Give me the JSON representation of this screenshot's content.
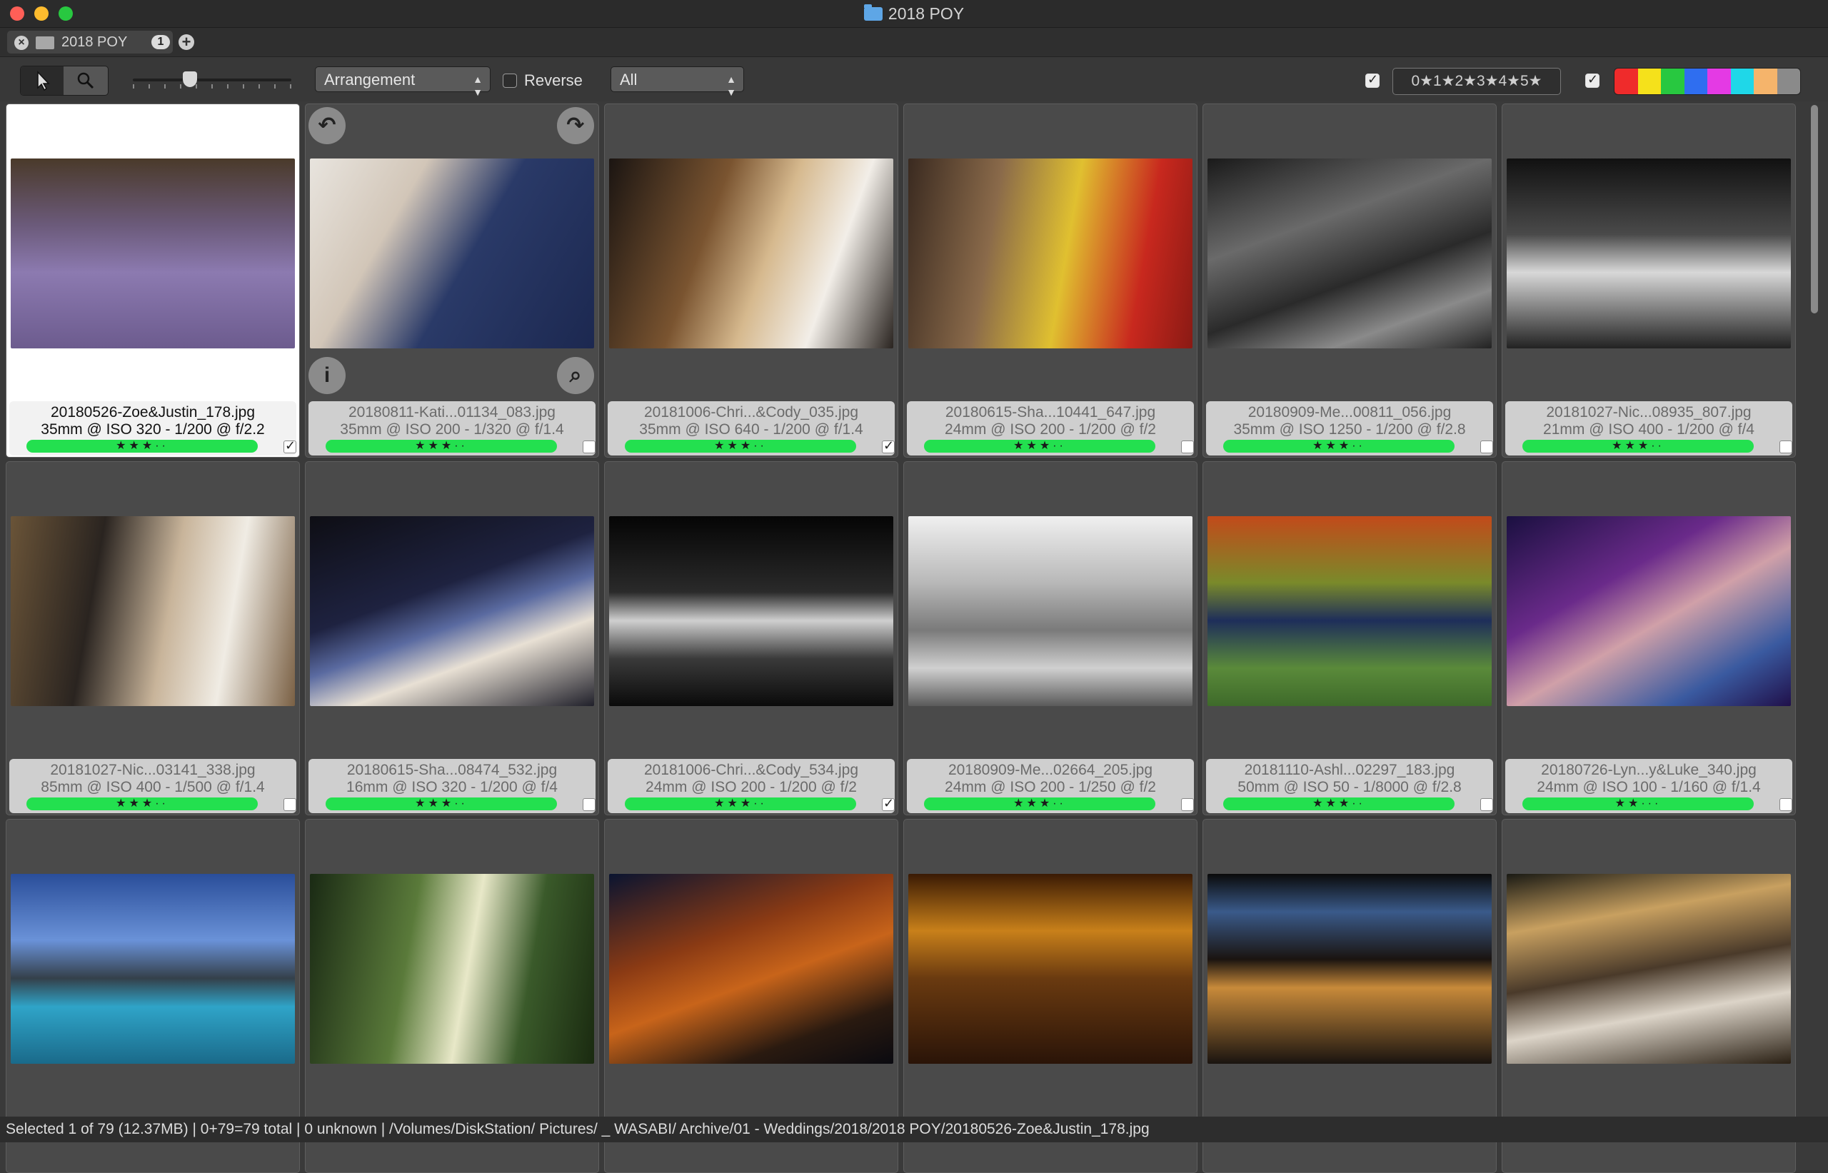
{
  "window": {
    "title": "2018 POY"
  },
  "tab": {
    "label": "2018 POY",
    "count": "1"
  },
  "toolbar": {
    "sort": "Arrangement",
    "reverse_label": "Reverse",
    "filter": "All",
    "rating_filter": "0★1★2★3★4★5★",
    "color_labels": [
      "#ef2b2b",
      "#f5e11b",
      "#28c840",
      "#2f6ef0",
      "#e43ae4",
      "#1fd7e8",
      "#f5b46b",
      "#8a8a8a"
    ]
  },
  "grid": {
    "cells": [
      {
        "file": "20180526-Zoe&Justin_178.jpg",
        "exif": "35mm @ ISO 320 - 1/200 @ f/2.2",
        "stars": "★★★··",
        "checked": true,
        "selected": true,
        "thumb": "linear-gradient(180deg,#4a3a2a 0%,#6b5a7a 35%,#8c7ab0 60%,#6c5b8e 100%)"
      },
      {
        "file": "20180811-Kati...01134_083.jpg",
        "exif": "35mm @ ISO 200 - 1/320 @ f/1.4",
        "stars": "★★★··",
        "checked": false,
        "hover": true,
        "thumb": "linear-gradient(120deg,#e8e4de 0%,#d2c6b8 30%,#2a3a68 55%,#1c2850 100%)"
      },
      {
        "file": "20181006-Chri...&Cody_035.jpg",
        "exif": "35mm @ ISO 640 - 1/200 @ f/1.4",
        "stars": "★★★··",
        "checked": true,
        "thumb": "linear-gradient(110deg,#1b1512 0%,#7a5430 35%,#d6b98e 55%,#f2eee8 75%,#2a2420 100%)"
      },
      {
        "file": "20180615-Sha...10441_647.jpg",
        "exif": "24mm @ ISO 200 - 1/200 @ f/2",
        "stars": "★★★··",
        "checked": false,
        "thumb": "linear-gradient(100deg,#3a2a20 0%,#8a6a4a 30%,#e0c030 55%,#c8281e 80%,#8a1a14 100%)"
      },
      {
        "file": "20180909-Me...00811_056.jpg",
        "exif": "35mm @ ISO 1250 - 1/200 @ f/2.8",
        "stars": "★★★··",
        "checked": false,
        "thumb": "linear-gradient(160deg,#1a1a1a 0%,#6a6a6a 35%,#2a2a2a 60%,#8a8a8a 80%,#222 100%)"
      },
      {
        "file": "20181027-Nic...08935_807.jpg",
        "exif": "21mm @ ISO 400 - 1/200 @ f/4",
        "stars": "★★★··",
        "checked": false,
        "thumb": "linear-gradient(180deg,#111 0%,#4a4a4a 40%,#d8d8d8 60%,#222 100%)"
      },
      {
        "file": "20181027-Nic...03141_338.jpg",
        "exif": "85mm @ ISO 400 - 1/500 @ f/1.4",
        "stars": "★★★··",
        "checked": false,
        "thumb": "linear-gradient(100deg,#6a5438 0%,#2a2420 30%,#c8b49a 55%,#f0ece4 75%,#7a6044 100%)"
      },
      {
        "file": "20180615-Sha...08474_532.jpg",
        "exif": "16mm @ ISO 320 - 1/200 @ f/4",
        "stars": "★★★··",
        "checked": false,
        "thumb": "linear-gradient(160deg,#0e0e14 0%,#1e2240 40%,#5a6aa0 55%,#e8e0d4 70%,#20202a 100%)"
      },
      {
        "file": "20181006-Chri...&Cody_534.jpg",
        "exif": "24mm @ ISO 200 - 1/200 @ f/2",
        "stars": "★★★··",
        "checked": true,
        "thumb": "linear-gradient(180deg,#050505 0%,#2a2a2a 40%,#cfcfcf 55%,#3a3a3a 75%,#0a0a0a 100%)"
      },
      {
        "file": "20180909-Me...02664_205.jpg",
        "exif": "24mm @ ISO 200 - 1/250 @ f/2",
        "stars": "★★★··",
        "checked": false,
        "thumb": "linear-gradient(180deg,#f0f0f0 0%,#b8b8b8 35%,#7a7a7a 60%,#d0d0d0 80%,#5a5a5a 100%)"
      },
      {
        "file": "20181110-Ashl...02297_183.jpg",
        "exif": "50mm @ ISO 50 - 1/8000 @ f/2.8",
        "stars": "★★★··",
        "checked": false,
        "thumb": "linear-gradient(180deg,#c24a1a 0%,#7a8a2a 35%,#1e2e5a 55%,#5a8a3a 80%,#3e6a2a 100%)"
      },
      {
        "file": "20180726-Lyn...y&Luke_340.jpg",
        "exif": "24mm @ ISO 100 - 1/160 @ f/1.4",
        "stars": "★★···",
        "checked": false,
        "thumb": "linear-gradient(150deg,#1a1040 0%,#6a2a8a 35%,#d0a0a8 55%,#3a5aa0 80%,#20104a 100%)"
      },
      {
        "file": "",
        "exif": "",
        "stars": "",
        "checked": false,
        "noinfo": true,
        "thumb": "linear-gradient(180deg,#2a4e9a 0%,#6a92d8 35%,#34404a 55%,#2fa4c8 70%,#1a6a8a 100%)"
      },
      {
        "file": "",
        "exif": "",
        "stars": "",
        "checked": false,
        "noinfo": true,
        "thumb": "linear-gradient(100deg,#1a2a14 0%,#5a7a3a 35%,#e8e8c8 55%,#3a5a2a 75%,#1a2a10 100%)"
      },
      {
        "file": "",
        "exif": "",
        "stars": "",
        "checked": false,
        "noinfo": true,
        "thumb": "linear-gradient(160deg,#0a1430 0%,#8a3a14 35%,#c8641a 55%,#2a1a10 80%,#0a0a10 100%)"
      },
      {
        "file": "",
        "exif": "",
        "stars": "",
        "checked": false,
        "noinfo": true,
        "thumb": "linear-gradient(180deg,#3a1a04 0%,#c8801a 30%,#6a3a10 55%,#2a1408 100%)"
      },
      {
        "file": "",
        "exif": "",
        "stars": "",
        "checked": false,
        "noinfo": true,
        "thumb": "linear-gradient(180deg,#0a0a0a 0%,#3a5a8a 20%,#1a1410 45%,#c88a3a 60%,#1a1410 100%)"
      },
      {
        "file": "",
        "exif": "",
        "stars": "",
        "checked": false,
        "noinfo": true,
        "thumb": "linear-gradient(170deg,#1a1a14 0%,#c8a060 25%,#4a3a2a 50%,#dcd4c8 70%,#2a2014 100%)"
      }
    ]
  },
  "status": {
    "text": "Selected 1 of 79 (12.37MB) | 0+79=79 total | 0 unknown | /Volumes/DiskStation/ Pictures/  _ WASABI/ Archive/01 - Weddings/2018/2018 POY/20180526-Zoe&Justin_178.jpg"
  }
}
